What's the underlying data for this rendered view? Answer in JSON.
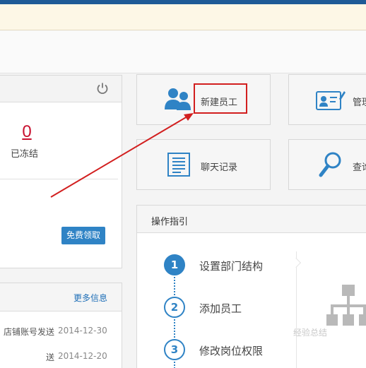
{
  "account": {
    "frozen_count": "0",
    "frozen_label": "已冻结",
    "free_button": "免费领取"
  },
  "news": {
    "more_label": "更多信息",
    "items": [
      {
        "title": "店铺账号发送",
        "date": "2014-12-30"
      },
      {
        "title": "送",
        "date": "2014-12-20"
      }
    ]
  },
  "tiles": {
    "new_employee": "新建员工",
    "chat_records": "聊天记录",
    "manage": "管理",
    "query": "查询"
  },
  "guide": {
    "title": "操作指引",
    "steps": [
      {
        "num": "1",
        "label": "设置部门结构"
      },
      {
        "num": "2",
        "label": "添加员工"
      },
      {
        "num": "3",
        "label": "修改岗位权限"
      }
    ]
  },
  "watermark": "经验总结"
}
